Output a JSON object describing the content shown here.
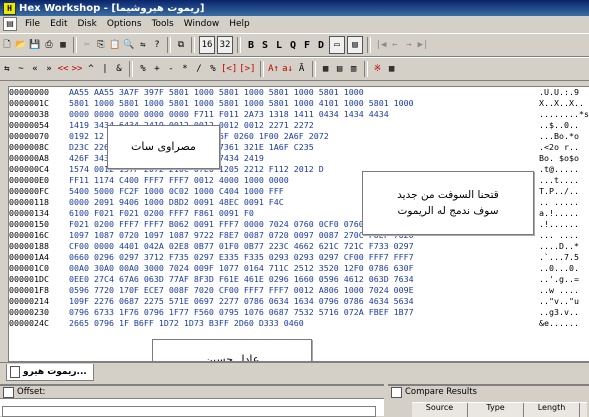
{
  "title": "Hex Workshop - [ريموت هيروشيما]",
  "menu": [
    "File",
    "Edit",
    "Disk",
    "Options",
    "Tools",
    "Window",
    "Help"
  ],
  "toolbar1": [
    "16",
    "32",
    "B",
    "S",
    "L",
    "Q",
    "F",
    "D"
  ],
  "toolbar2": [
    "⇆",
    "~",
    "«",
    "»",
    "<<",
    ">>",
    "&",
    "%",
    "+",
    "-",
    "*",
    "/",
    "%",
    "[<]",
    "[>]",
    "A↑",
    "a↓",
    "Ā",
    "⇄"
  ],
  "hex_rows": [
    {
      "offset": "00000000",
      "hex": "AA55 AA55 3A7F 397F 5801 1000 5801 1000 5801 1000 5801 1000",
      "ascii": ".U.U.:.9"
    },
    {
      "offset": "0000001C",
      "hex": "5801 1000 5801 1000 5801 1000 5801 1000 5801 1000 4101 1000 5801 1000",
      "ascii": "X..X..X.."
    },
    {
      "offset": "00000038",
      "hex": "0000 0000 0000 0000 0000 F711 F011 2A73 1318 1411 0434 1434 4434",
      "ascii": "........*s"
    },
    {
      "offset": "00000054",
      "hex": "1419       3434 6434 2419 0012 0012 0012 0012 2271 2272",
      "ascii": "..$..0.."
    },
    {
      "offset": "00000070",
      "hex": "0192       12 227F 237F B233 1F00 426F 0260 1F00 2A6F 2072",
      "ascii": "...Bo.*o"
    },
    {
      "offset": "0000008C",
      "hex": "D23C       226F F261 126F 1E72 623E 7361 321E 1A6F C235",
      "ascii": ".<2o r.."
    },
    {
      "offset": "000000A8",
      "hex": "426F       3434 3434 4434 5434 6434 7434 2419",
      "ascii": "Bo. $o$o"
    },
    {
      "offset": "000000C4",
      "hex": "1574 0012 157F 2072 210C 07E0 1205 2212 F112 2012 D",
      "ascii": ".t@....."
    },
    {
      "offset": "000000E0",
      "hex": "FF11 1174 C400 FFF7 FFF7 0012 4000 1000 0000",
      "ascii": "...t...."
    },
    {
      "offset": "000000FC",
      "hex": "5400 5000 FC2F 1000 0C02 1000 C404 1000 FFF",
      "ascii": "T.P../.."
    },
    {
      "offset": "00000118",
      "hex": "0000 2091 9406 1000 D8D2 0091 48EC 0091 F4C",
      "ascii": ".. ....."
    },
    {
      "offset": "00000134",
      "hex": "6100 F021 F021 0200 FFF7 F861 0091 F0",
      "ascii": "a.!....."
    },
    {
      "offset": "00000150",
      "hex": "F021 0200 FFF7 FFF7 B062 0091 FFF7 0000 7024 0760 0CF0 0760 04F0",
      "ascii": ".!......"
    },
    {
      "offset": "0000016C",
      "hex": "1097 1087 0720 1097 1087 9722 F8E7 0087 0720 0097 0087 270C F0EF 7020",
      "ascii": "... ...."
    },
    {
      "offset": "00000188",
      "hex": "CF00 0000 4401 042A 02E8 0B77 01F0 0B77 223C 4662 621C 721C F733 0297",
      "ascii": "....D..*"
    },
    {
      "offset": "000001A4",
      "hex": "0660 0296 0297 3712 F735 0297 E335 F335 0293 0293 0297 CF00 FFF7 FFF7",
      "ascii": ".`...7.5"
    },
    {
      "offset": "000001C0",
      "hex": "00A0 30A0 00A0 3000 7024 009F 1077 0164 711C 2512 3520 12F0 0786 630F",
      "ascii": "..0...0."
    },
    {
      "offset": "000001DC",
      "hex": "0EE0 27C4 67A6 063D 77AF 8F3D F61E 461E 0296 1660 0596 4612 063D 7634",
      "ascii": "..'.g..="
    },
    {
      "offset": "000001F8",
      "hex": "0596 7720 170F ECE7 008F 7020 CF00 FFF7 FFF7 0012 A806 1000 7024 009E",
      "ascii": "..w ...."
    },
    {
      "offset": "00000214",
      "hex": "109F 2276 0687 2275 571E 0697 2277 0786 0634 1634 0796 0786 4634 5634",
      "ascii": "..\"v..\"u"
    },
    {
      "offset": "00000230",
      "hex": "0796 6733 1F76 0796 1F77 F560 0795 1076 0687 7532 5716 072A FBEF 1B77",
      "ascii": "..g3.v.."
    },
    {
      "offset": "0000024C",
      "hex": "2665 0796 1F         B6FF 1D72 1D73 B3FF 2D60 D333 0460",
      "ascii": "&e......"
    }
  ],
  "overlays": {
    "box1": "مصراوى سات",
    "box2_line1": "قتحنا السوفت من جديد",
    "box2_line2": "سوف ندمج له الريموت",
    "box3": "عادل حسين"
  },
  "tab_label": "ريموت هيرو...",
  "bottom": {
    "offset_label": "Offset:",
    "compare_label": "Compare Results",
    "col1": "Source",
    "col2": "Type",
    "col3": "Length"
  }
}
